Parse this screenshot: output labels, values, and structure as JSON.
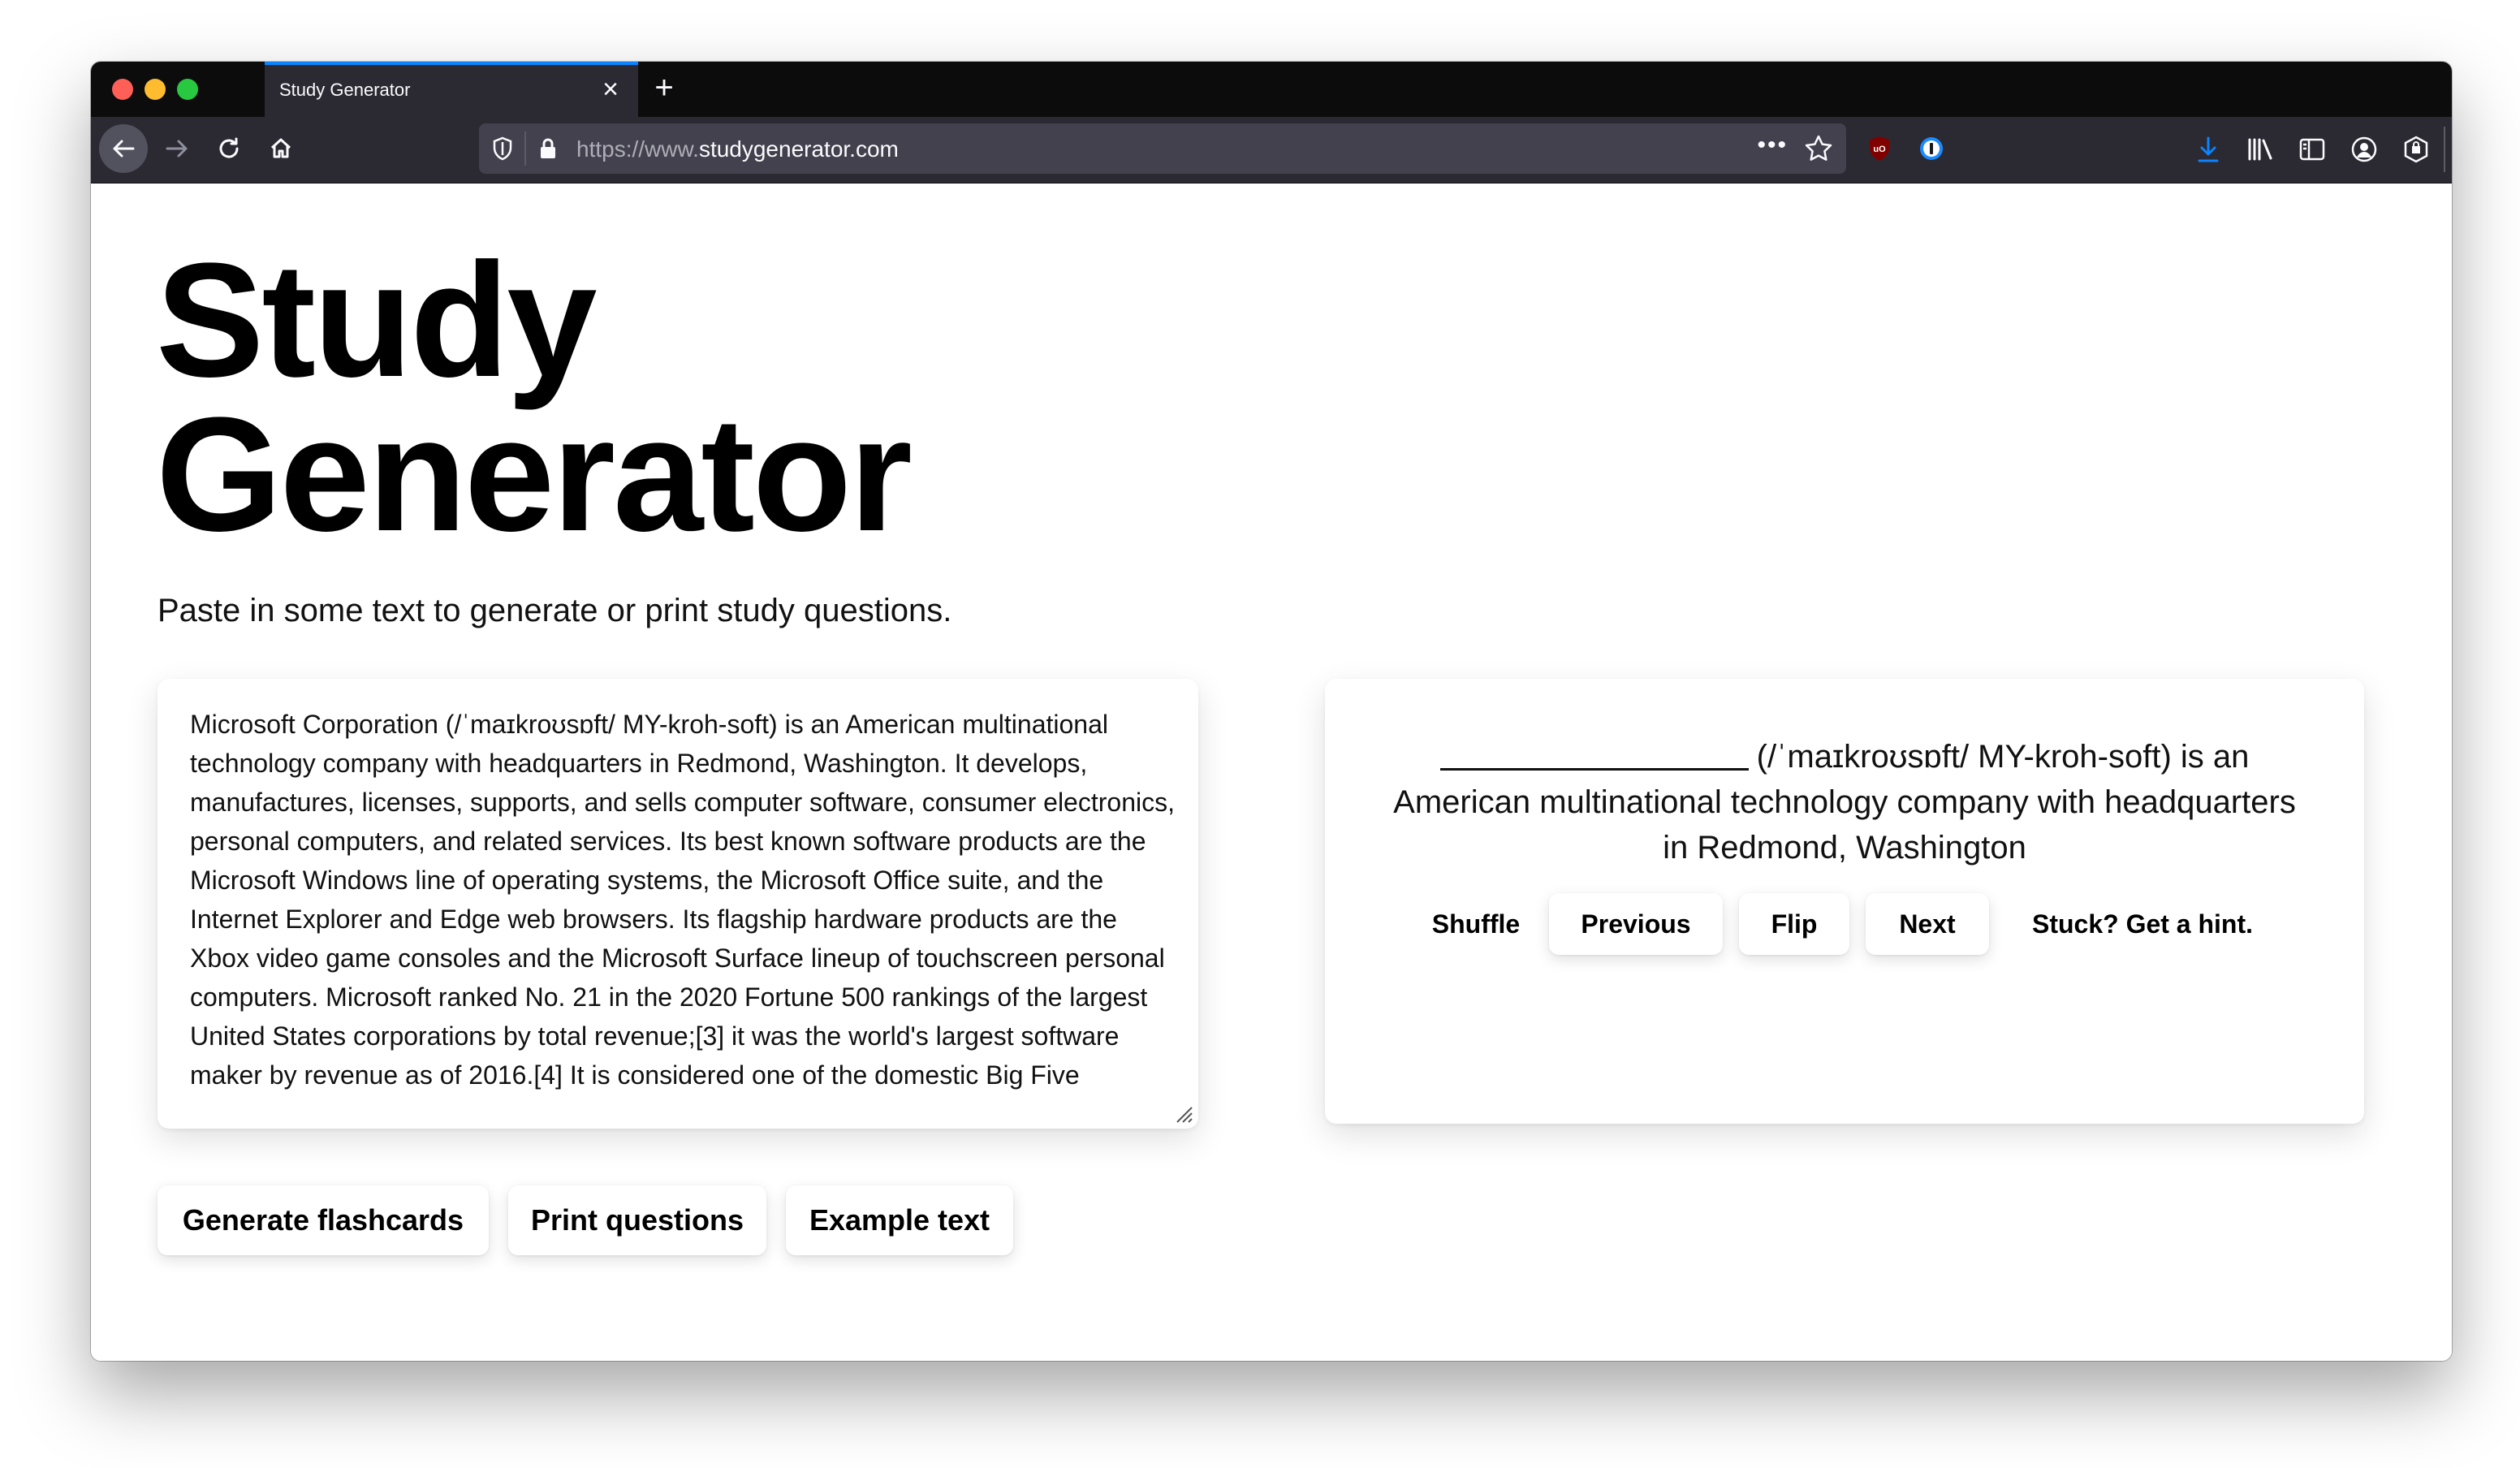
{
  "browser": {
    "tab_title": "Study Generator",
    "tab_close": "×",
    "new_tab": "+",
    "url_prefix": "https://www.",
    "url_domain": "studygenerator.com",
    "page_actions": "•••"
  },
  "page": {
    "title": "Study Generator",
    "subtitle": "Paste in some text to generate or print study questions.",
    "source_text": "Microsoft Corporation (/ˈmaɪkroʊsɒft/ MY-kroh-soft) is an American multinational technology company with headquarters in Redmond, Washington. It develops, manufactures, licenses, supports, and sells computer software, consumer electronics, personal computers, and related services. Its best known software products are the Microsoft Windows line of operating systems, the Microsoft Office suite, and the Internet Explorer and Edge web browsers. Its flagship hardware products are the Xbox video game consoles and the Microsoft Surface lineup of touchscreen personal computers. Microsoft ranked No. 21 in the 2020 Fortune 500 rankings of the largest United States corporations by total revenue;[3] it was the world's largest software maker by revenue as of 2016.[4] It is considered one of the domestic Big Five",
    "buttons": {
      "generate": "Generate flashcards",
      "print": "Print questions",
      "example": "Example text"
    }
  },
  "flashcard": {
    "question_rest": "(/ˈmaɪkroʊsɒft/ MY-kroh-soft) is an American multinational technology company with headquarters in Redmond, Washington",
    "controls": {
      "shuffle": "Shuffle",
      "previous": "Previous",
      "flip": "Flip",
      "next": "Next",
      "hint": "Stuck? Get a hint."
    }
  },
  "colors": {
    "tab_accent": "#0a84ff",
    "toolbar_bg": "#2b2a33",
    "tabstrip_bg": "#0c0c0d",
    "download_icon": "#0a84ff"
  }
}
